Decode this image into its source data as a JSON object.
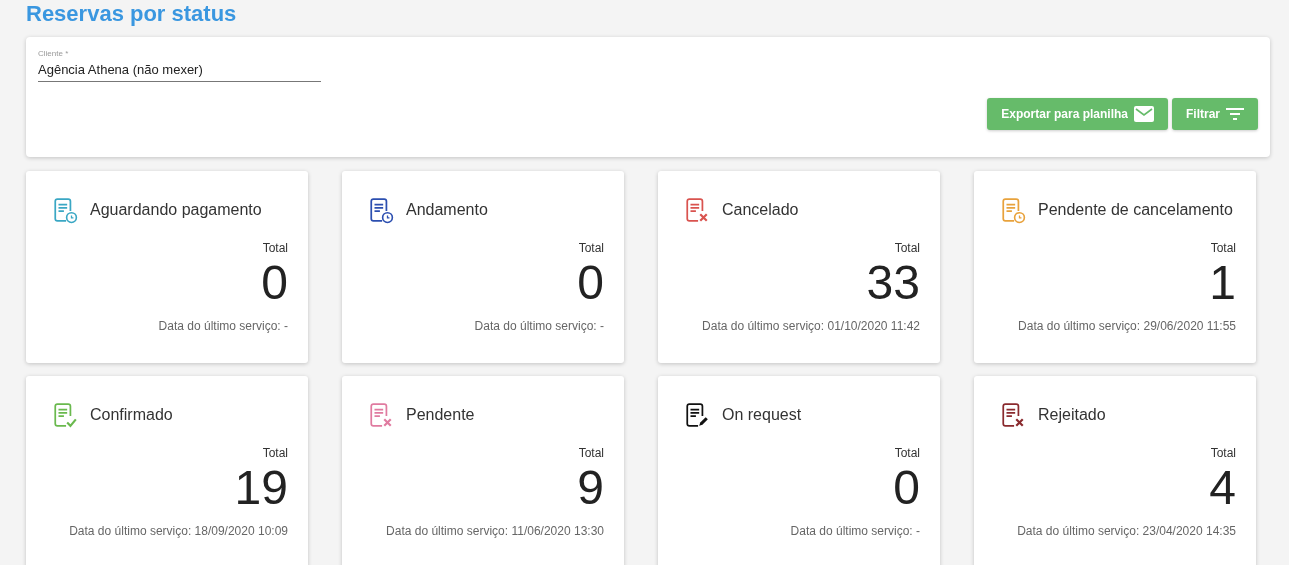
{
  "title": "Reservas por status",
  "filter": {
    "label": "Cliente *",
    "value": "Agência Athena (não mexer)"
  },
  "buttons": [
    {
      "label": "Exportar para planilha",
      "kind": "mail"
    },
    {
      "label": "Filtrar",
      "kind": "filter"
    }
  ],
  "cards": [
    {
      "name": "Aguardando pagamento",
      "kind": "clock",
      "color": "#3aa7c4",
      "total_label": "Total",
      "total": "0",
      "last_service": "Data do último serviço: -"
    },
    {
      "name": "Andamento",
      "kind": "clock",
      "color": "#2c4fb0",
      "total_label": "Total",
      "total": "0",
      "last_service": "Data do último serviço: -"
    },
    {
      "name": "Cancelado",
      "kind": "x",
      "color": "#d9534f",
      "total_label": "Total",
      "total": "33",
      "last_service": "Data do último serviço: 01/10/2020 11:42"
    },
    {
      "name": "Pendente de cancelamento",
      "kind": "clock",
      "color": "#e8a23c",
      "total_label": "Total",
      "total": "1",
      "last_service": "Data do último serviço: 29/06/2020 11:55"
    },
    {
      "name": "Confirmado",
      "kind": "check",
      "color": "#6ab94e",
      "total_label": "Total",
      "total": "19",
      "last_service": "Data do último serviço: 18/09/2020 10:09"
    },
    {
      "name": "Pendente",
      "kind": "x",
      "color": "#e07ba0",
      "total_label": "Total",
      "total": "9",
      "last_service": "Data do último serviço: 11/06/2020 13:30"
    },
    {
      "name": "On request",
      "kind": "pencil",
      "color": "#111111",
      "total_label": "Total",
      "total": "0",
      "last_service": "Data do último serviço: -"
    },
    {
      "name": "Rejeitado",
      "kind": "x",
      "color": "#8a2a2e",
      "total_label": "Total",
      "total": "4",
      "last_service": "Data do último serviço: 23/04/2020 14:35"
    }
  ]
}
